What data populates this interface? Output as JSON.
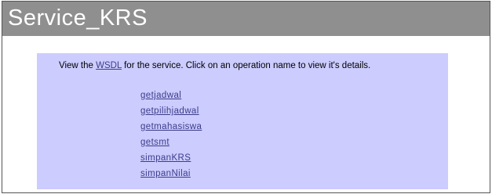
{
  "page": {
    "title": "Service_KRS"
  },
  "intro": {
    "prefix": "View the ",
    "wsdl_link": "WSDL",
    "suffix": " for the service. Click on an operation name to view it's details."
  },
  "operations": [
    {
      "label": "getjadwal"
    },
    {
      "label": "getpilihjadwal"
    },
    {
      "label": "getmahasiswa"
    },
    {
      "label": "getsmt"
    },
    {
      "label": "simpanKRS"
    },
    {
      "label": "simpanNilai"
    }
  ]
}
